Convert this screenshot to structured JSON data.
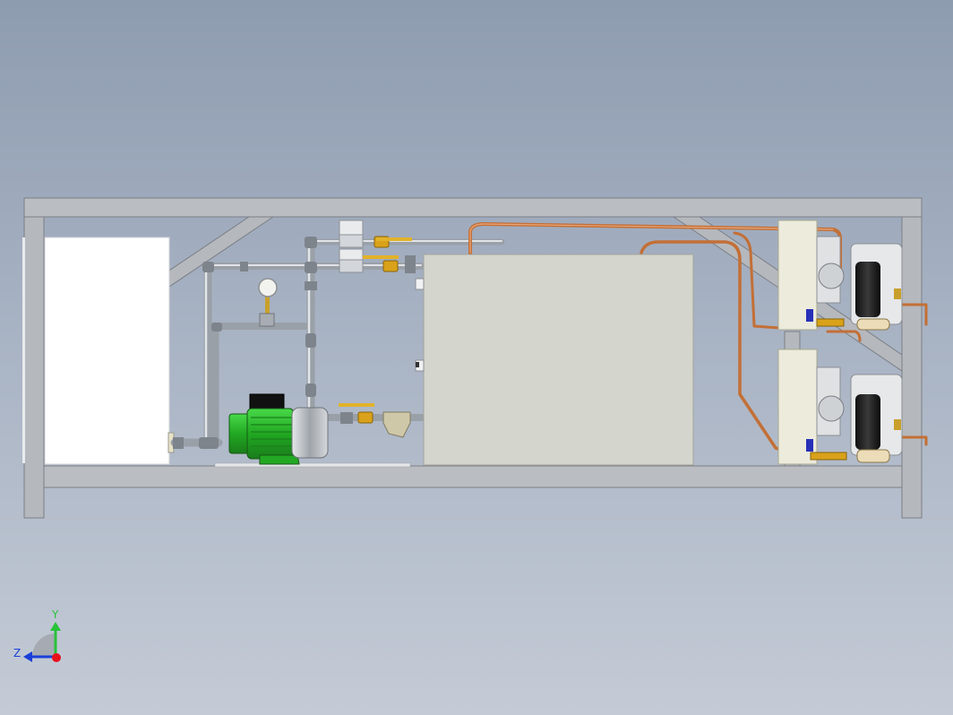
{
  "triad": {
    "y_label": "Y",
    "z_label": "Z",
    "x_color": "#e8101a",
    "y_color": "#27c23a",
    "z_color": "#1a3fd8"
  },
  "colors": {
    "frame": "#b9bcc1",
    "frame_edge": "#7d8086",
    "pipe": "#b8bdc4",
    "copper": "#c8733b",
    "motor": "#2fc42f",
    "valve": "#d9a21a",
    "tank": "#d3d4cb"
  }
}
